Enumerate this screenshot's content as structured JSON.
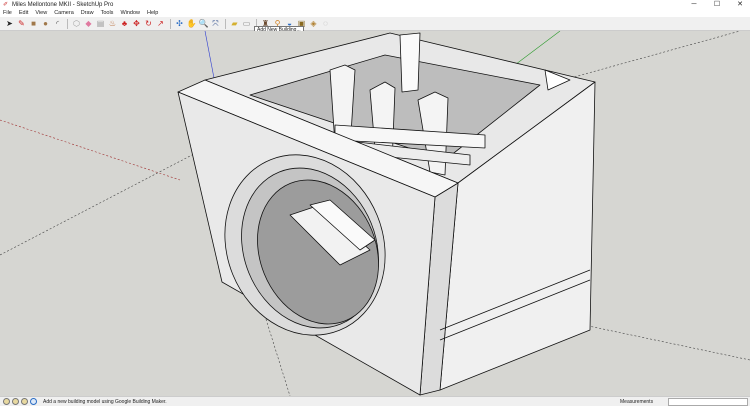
{
  "window": {
    "title": "Miles Mellontone MKII - SketchUp Pro",
    "minimize": "─",
    "maximize": "☐",
    "close": "✕"
  },
  "menu": [
    "File",
    "Edit",
    "View",
    "Camera",
    "Draw",
    "Tools",
    "Window",
    "Help"
  ],
  "toolbar": {
    "tools": [
      {
        "name": "select-icon",
        "glyph": "➤",
        "color": "#222"
      },
      {
        "name": "pencil-icon",
        "glyph": "✎",
        "color": "#c22"
      },
      {
        "name": "rectangle-icon",
        "glyph": "■",
        "color": "#a0784a"
      },
      {
        "name": "circle-icon",
        "glyph": "●",
        "color": "#a0784a"
      },
      {
        "name": "arc-icon",
        "glyph": "◜",
        "color": "#555"
      },
      {
        "name": "make-component-icon",
        "glyph": "⬡",
        "color": "#999"
      },
      {
        "name": "eraser-icon",
        "glyph": "◆",
        "color": "#e07aa0"
      },
      {
        "name": "tape-measure-icon",
        "glyph": "▤",
        "color": "#999"
      },
      {
        "name": "paint-bucket-icon",
        "glyph": "♨",
        "color": "#b05a20"
      },
      {
        "name": "push-pull-icon",
        "glyph": "♣",
        "color": "#c22"
      },
      {
        "name": "move-icon",
        "glyph": "✥",
        "color": "#c22"
      },
      {
        "name": "rotate-icon",
        "glyph": "↻",
        "color": "#c22"
      },
      {
        "name": "offset-icon",
        "glyph": "↗",
        "color": "#c22"
      },
      {
        "name": "orbit-icon",
        "glyph": "✣",
        "color": "#2a6cc4"
      },
      {
        "name": "pan-icon",
        "glyph": "✋",
        "color": "#555"
      },
      {
        "name": "zoom-icon",
        "glyph": "🔍",
        "color": "#2a4a8a"
      },
      {
        "name": "zoom-extents-icon",
        "glyph": "⤧",
        "color": "#2a4a8a"
      },
      {
        "name": "warehouse-icon",
        "glyph": "▰",
        "color": "#d4b030"
      },
      {
        "name": "share-model-icon",
        "glyph": "▭",
        "color": "#888"
      },
      {
        "name": "add-building-icon",
        "glyph": "♜",
        "color": "#6a4a30"
      },
      {
        "name": "add-location-icon",
        "glyph": "⚲",
        "color": "#d08020"
      },
      {
        "name": "photo-texture-icon",
        "glyph": "◒",
        "color": "#2a6cc4"
      },
      {
        "name": "extension-warehouse-icon",
        "glyph": "▣",
        "color": "#8a6a20"
      },
      {
        "name": "components-icon",
        "glyph": "◈",
        "color": "#b08030"
      },
      {
        "name": "geo-icon",
        "glyph": "◌",
        "color": "#999"
      }
    ],
    "tooltip": "Add New Building..."
  },
  "status": {
    "message": "Add a new building model using Google Building Maker.",
    "measurements_label": "Measurements",
    "measurements_value": ""
  },
  "colors": {
    "viewport": "#d6d6d2",
    "face": "#f1f1f1",
    "face_shadow": "#d0d0d0",
    "edge": "#111"
  }
}
